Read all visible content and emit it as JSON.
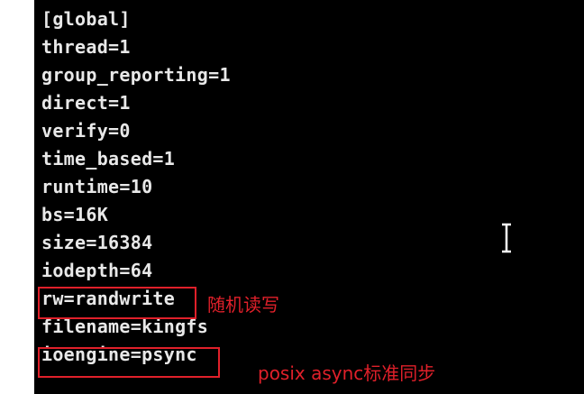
{
  "terminal": {
    "background_color": "#000000",
    "text_color": "#e8e8e8",
    "lines": [
      "[global]",
      "thread=1",
      "group_reporting=1",
      "direct=1",
      "verify=0",
      "time_based=1",
      "runtime=10",
      "bs=16K",
      "size=16384",
      "iodepth=64",
      "rw=randwrite",
      "filename=kingfs",
      "ioengine=psync"
    ]
  },
  "annotations": {
    "color": "#e0202a",
    "rw_note": "随机读写",
    "ioengine_note": "posix async标准同步"
  },
  "cursor": {
    "icon": "i-beam-text-cursor-icon"
  }
}
